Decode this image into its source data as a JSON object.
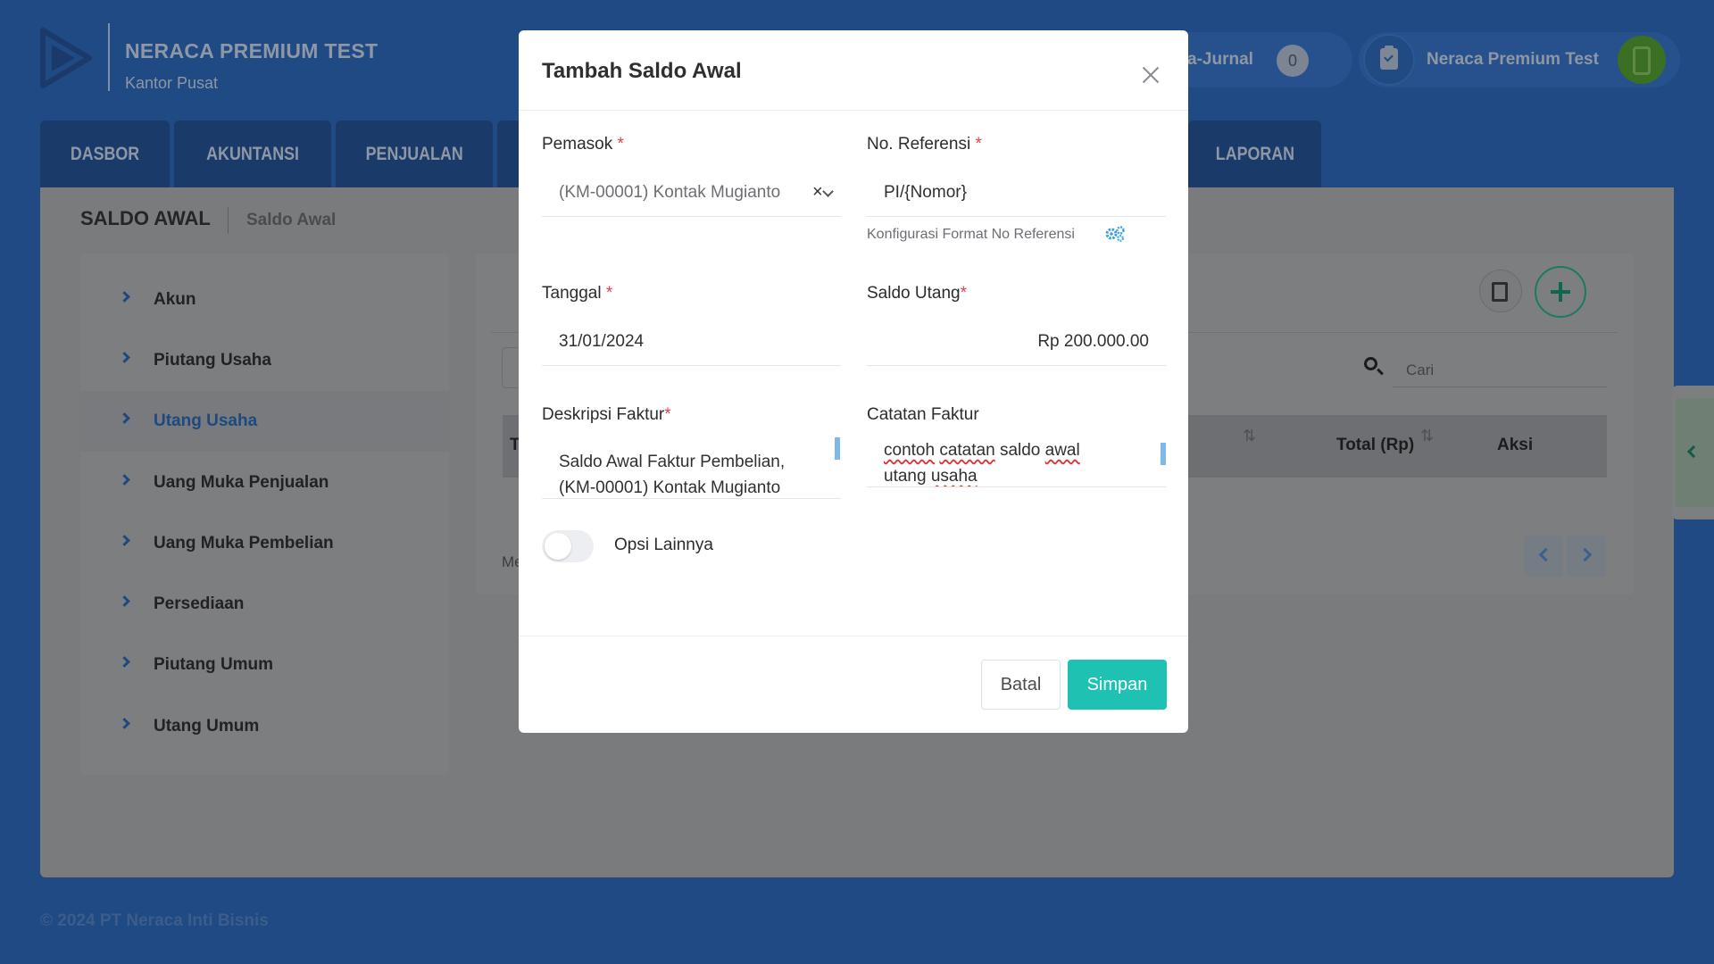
{
  "brand": {
    "name": "NERACA PREMIUM TEST",
    "branch": "Kantor Pusat"
  },
  "topbar": {
    "ejurnal_label": "a-Jurnal",
    "ejurnal_count": "0",
    "user_name": "Neraca Premium Test"
  },
  "nav": {
    "tabs": [
      "DASBOR",
      "AKUNTANSI",
      "PENJUALAN",
      "LAPORAN"
    ]
  },
  "page": {
    "title": "SALDO AWAL",
    "breadcrumb": "Saldo Awal"
  },
  "sidebar": {
    "items": [
      {
        "label": "Akun",
        "active": false
      },
      {
        "label": "Piutang Usaha",
        "active": false
      },
      {
        "label": "Utang Usaha",
        "active": true
      },
      {
        "label": "Uang Muka Penjualan",
        "active": false
      },
      {
        "label": "Uang Muka Pembelian",
        "active": false
      },
      {
        "label": "Persediaan",
        "active": false
      },
      {
        "label": "Piutang Umum",
        "active": false
      },
      {
        "label": "Utang Umum",
        "active": false
      }
    ]
  },
  "table": {
    "search_placeholder": "Cari",
    "col_first_partial": "T",
    "col_total": "Total (Rp)",
    "col_action": "Aksi",
    "footer_partial": "Me"
  },
  "footer": {
    "copyright": "© 2024 PT Neraca Inti Bisnis"
  },
  "modal": {
    "title": "Tambah Saldo Awal",
    "supplier": {
      "label": "Pemasok",
      "required_mark": "*",
      "value": "(KM-00001) Kontak Mugianto",
      "clear_glyph": "×"
    },
    "reference": {
      "label": "No. Referensi",
      "required_mark": "*",
      "value": "PI/{Nomor}",
      "helper": "Konfigurasi Format No Referensi"
    },
    "date": {
      "label": "Tanggal",
      "required_mark": "*",
      "value": "31/01/2024"
    },
    "payable": {
      "label": "Saldo Utang",
      "required_mark": "*",
      "value": "Rp 200.000.00"
    },
    "description": {
      "label": "Deskripsi Faktur",
      "required_mark": "*",
      "line1": "Saldo Awal Faktur Pembelian,",
      "line2": "(KM-00001) Kontak Mugianto"
    },
    "notes": {
      "label": "Catatan Faktur",
      "line1_words": [
        "contoh",
        "catatan",
        "saldo",
        "awal"
      ],
      "line2_words": [
        "utang",
        "usaha"
      ]
    },
    "other_options": {
      "label": "Opsi Lainnya",
      "enabled": false
    },
    "buttons": {
      "cancel": "Batal",
      "save": "Simpan"
    }
  },
  "colors": {
    "accent_teal": "#1fc2b2",
    "brand_blue": "#1f4a84",
    "required_red": "#e2424a"
  },
  "icons": [
    "logo-mark",
    "clipboard-icon",
    "phone-icon",
    "chevron-right-icon",
    "import-icon",
    "plus-icon",
    "search-icon",
    "sort-icon",
    "close-icon",
    "chevron-down-icon",
    "gear-icon"
  ]
}
